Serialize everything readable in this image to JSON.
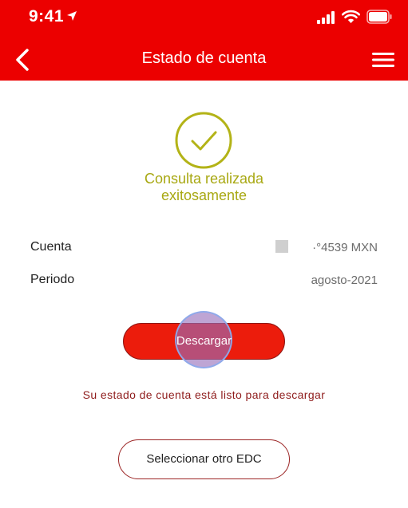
{
  "status_bar": {
    "time": "9:41"
  },
  "header": {
    "title": "Estado de cuenta"
  },
  "success": {
    "line1": "Consulta realizada",
    "line2": "exitosamente"
  },
  "details": {
    "account_label": "Cuenta",
    "account_value": "·°4539 MXN",
    "period_label": "Periodo",
    "period_value": "agosto-2021"
  },
  "actions": {
    "download_label": "Descargar",
    "ready_message": "Su estado de cuenta está listo para descargar",
    "select_other_label": "Seleccionar otro EDC"
  },
  "colors": {
    "brand_red": "#ec0000",
    "success_olive": "#a8a812",
    "message_maroon": "#8f1c1c"
  },
  "icons": [
    "location-arrow-icon",
    "signal-icon",
    "wifi-icon",
    "battery-icon",
    "back-chevron-icon",
    "hamburger-menu-icon",
    "checkmark-circle-icon"
  ]
}
